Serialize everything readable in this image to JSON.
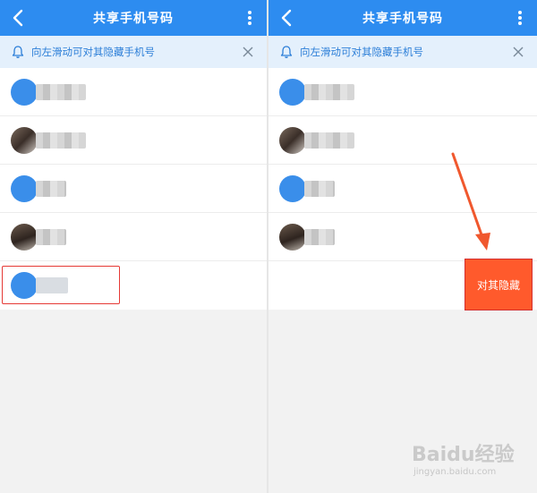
{
  "header": {
    "title": "共享手机号码"
  },
  "notice": {
    "text": "向左滑动可对其隐藏手机号"
  },
  "right_panel": {
    "hide_action_label": "对其隐藏"
  },
  "watermark": {
    "brand": "Baidu经验",
    "url": "jingyan.baidu.com"
  },
  "colors": {
    "header_bg": "#2d8cf0",
    "notice_bg": "#e4f0fc",
    "action_bg": "#ff5a2c",
    "highlight": "#e53935"
  }
}
